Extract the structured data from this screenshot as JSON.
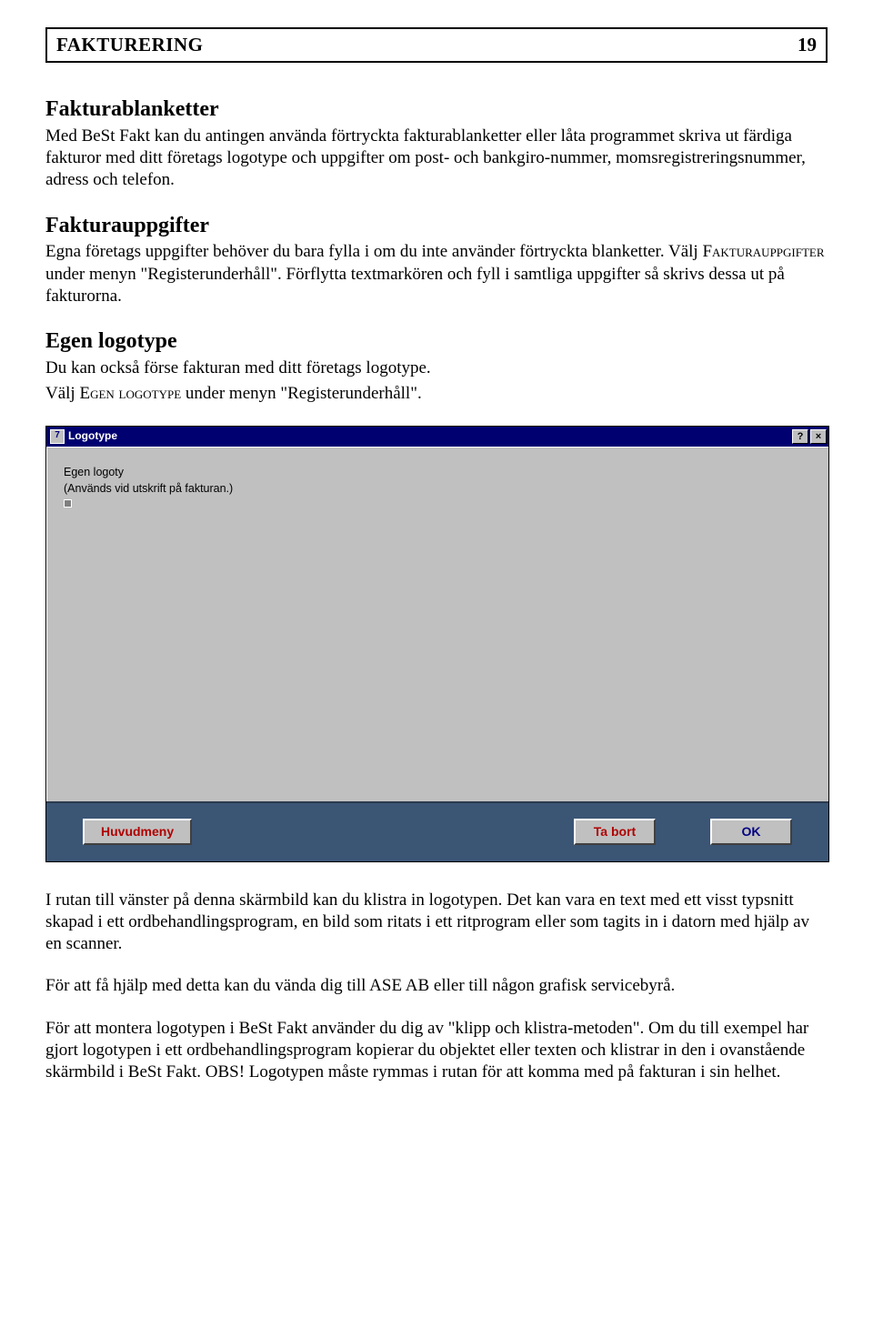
{
  "header": {
    "title": "FAKTURERING",
    "page_number": "19"
  },
  "s1": {
    "heading": "Fakturablanketter",
    "body": "Med BeSt Fakt kan du antingen använda förtryckta fakturablanketter eller låta programmet skriva ut färdiga fakturor med ditt företags logotype och uppgifter om post- och bankgiro-nummer, momsregistreringsnummer, adress och telefon."
  },
  "s2": {
    "heading": "Fakturauppgifter",
    "body_a": "Egna företags uppgifter behöver du bara fylla i om du inte använder förtryckta blanketter. Välj ",
    "sc1": "Fakturauppgifter",
    "body_b": " under menyn \"Registerunderhåll\". Förflytta textmarkören och fyll i samtliga uppgifter så skrivs dessa ut på fakturorna."
  },
  "s3": {
    "heading": "Egen logotype",
    "line1": "Du kan också förse fakturan med ditt företags logotype.",
    "line2_a": "Välj ",
    "line2_sc": "Egen logotype",
    "line2_b": " under menyn \"Registerunderhåll\"."
  },
  "dialog": {
    "icon_char": "7",
    "title": "Logotype",
    "help_char": "?",
    "close_char": "×",
    "body_line1": "Egen logoty",
    "body_line2": "(Används vid utskrift på fakturan.)",
    "btn_main": "Huvudmeny",
    "btn_delete": "Ta bort",
    "btn_ok": "OK"
  },
  "p_after1": "I rutan till vänster på denna skärmbild kan du klistra in logotypen. Det kan vara en text med ett visst typsnitt skapad i ett ordbehandlingsprogram, en bild som ritats i ett ritprogram eller som tagits in i datorn med hjälp av en scanner.",
  "p_after2": "För att få hjälp med detta kan du vända dig till ASE AB eller till någon grafisk servicebyrå.",
  "p_after3": "För att montera logotypen i BeSt Fakt använder du dig av \"klipp och klistra-metoden\". Om du till exempel har gjort logotypen i ett ordbehandlingsprogram kopierar du objektet eller texten och klistrar in den i ovanstående skärmbild i BeSt Fakt. OBS! Logotypen måste rymmas i rutan för att komma med på fakturan i sin helhet."
}
